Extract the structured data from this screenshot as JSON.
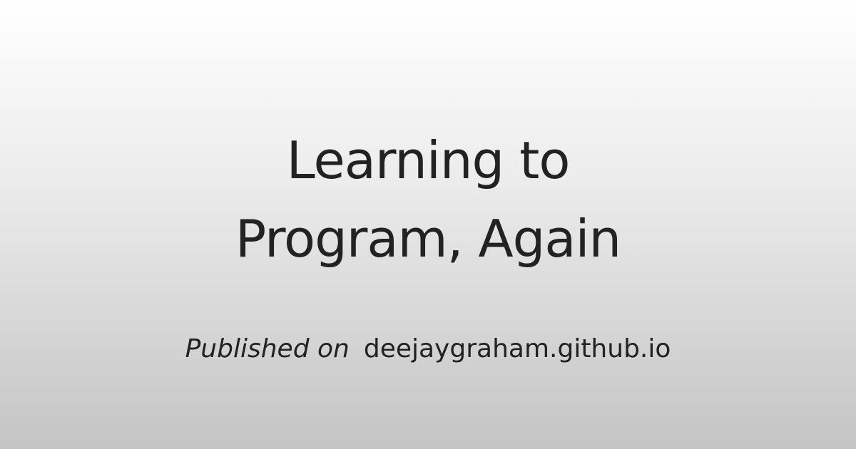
{
  "title": {
    "line1": "Learning to",
    "line2": "Program, Again"
  },
  "byline": {
    "prefix": "Published on",
    "site": "deejaygraham.github.io"
  }
}
